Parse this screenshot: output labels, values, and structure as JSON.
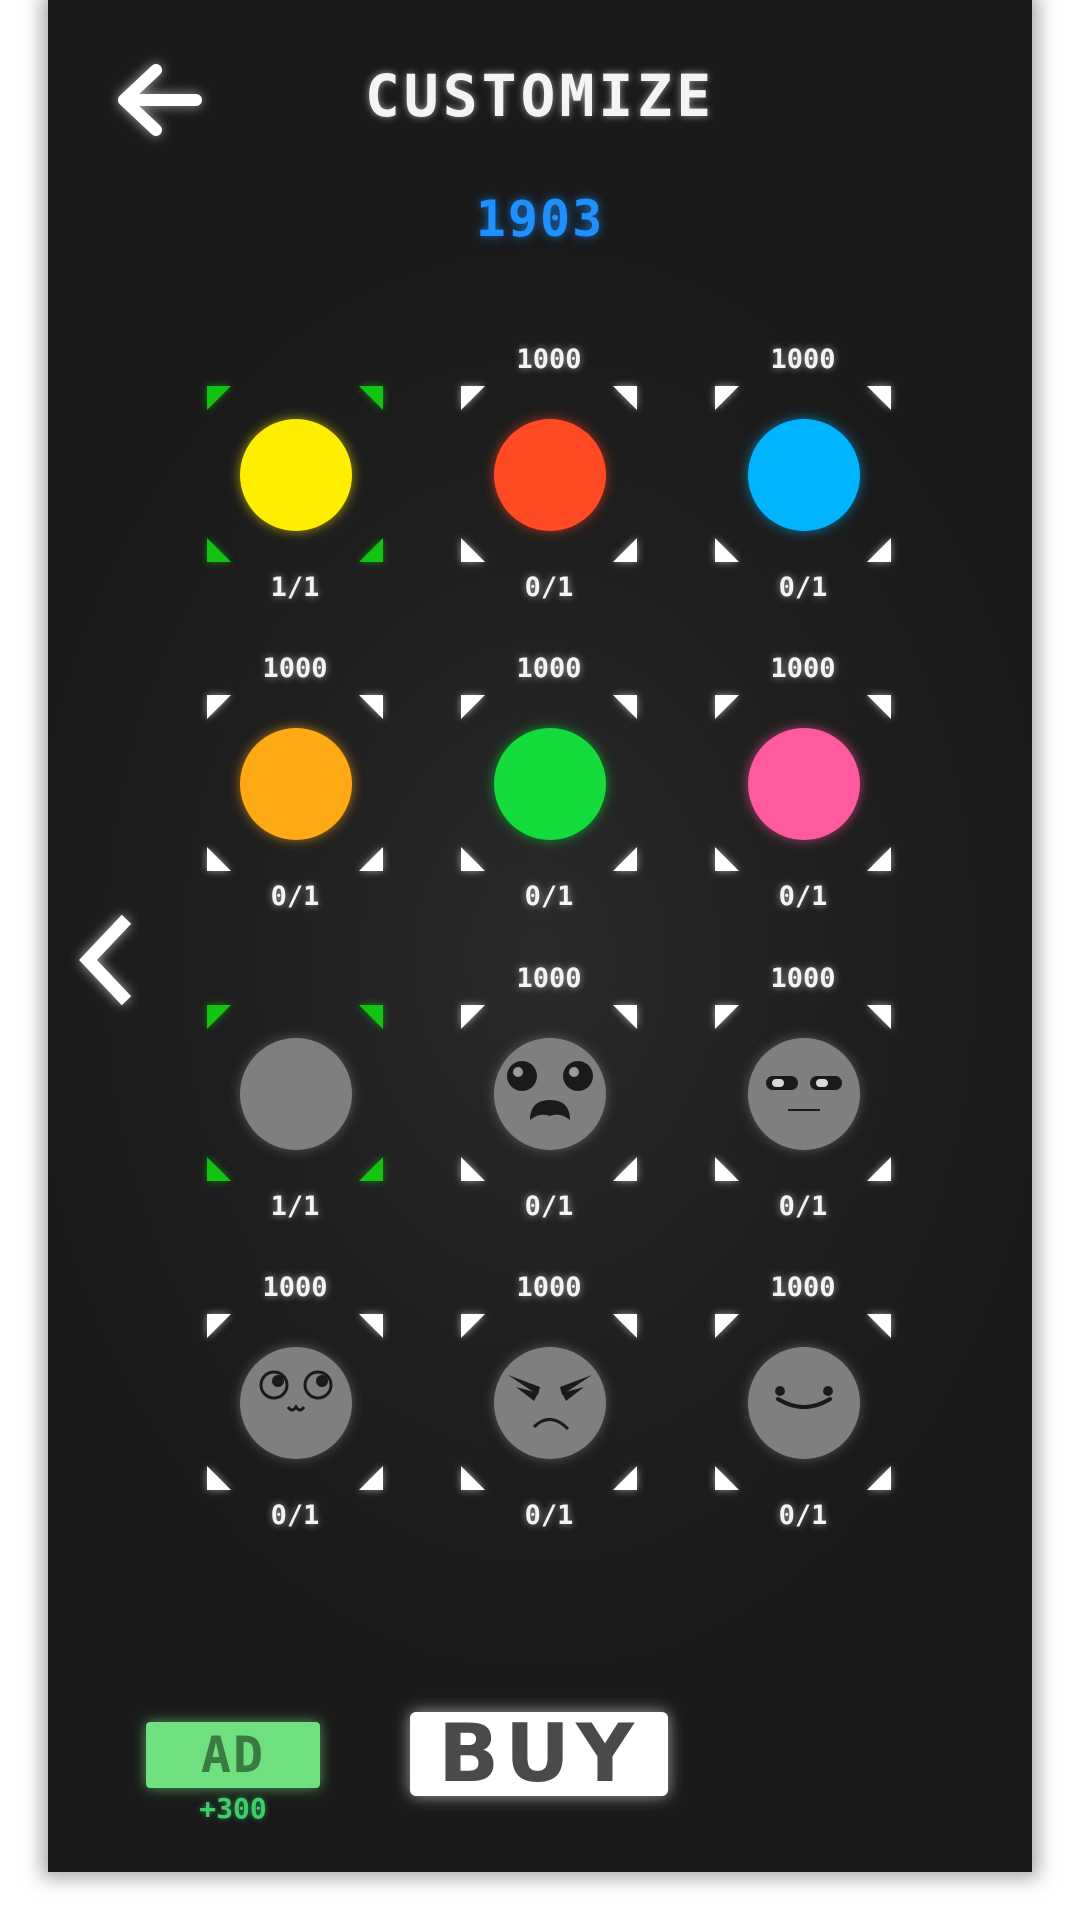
{
  "header": {
    "title": "CUSTOMIZE",
    "back_icon": "arrow-left-icon"
  },
  "wallet": {
    "coins": "1903",
    "color": "#1e90ff"
  },
  "navigation": {
    "prev_icon": "chevron-left-icon"
  },
  "items": [
    {
      "name": "yellow",
      "price": "",
      "count": "1/1",
      "owned": true,
      "color": "#ffee00",
      "face": "none"
    },
    {
      "name": "red",
      "price": "1000",
      "count": "0/1",
      "owned": false,
      "color": "#ff4a24",
      "face": "none"
    },
    {
      "name": "blue",
      "price": "1000",
      "count": "0/1",
      "owned": false,
      "color": "#00b4ff",
      "face": "none"
    },
    {
      "name": "orange",
      "price": "1000",
      "count": "0/1",
      "owned": false,
      "color": "#ffaa14",
      "face": "none"
    },
    {
      "name": "green",
      "price": "1000",
      "count": "0/1",
      "owned": false,
      "color": "#14dc3c",
      "face": "none"
    },
    {
      "name": "pink",
      "price": "1000",
      "count": "0/1",
      "owned": false,
      "color": "#ff5aa0",
      "face": "none"
    },
    {
      "name": "plain-gray",
      "price": "",
      "count": "1/1",
      "owned": true,
      "color": "#7f7f7f",
      "face": "none"
    },
    {
      "name": "scared-face",
      "price": "1000",
      "count": "0/1",
      "owned": false,
      "color": "#7f7f7f",
      "face": "scared"
    },
    {
      "name": "bored-face",
      "price": "1000",
      "count": "0/1",
      "owned": false,
      "color": "#7f7f7f",
      "face": "bored"
    },
    {
      "name": "cute-face",
      "price": "1000",
      "count": "0/1",
      "owned": false,
      "color": "#7f7f7f",
      "face": "cute"
    },
    {
      "name": "angry-face",
      "price": "1000",
      "count": "0/1",
      "owned": false,
      "color": "#7f7f7f",
      "face": "angry"
    },
    {
      "name": "smile-face",
      "price": "1000",
      "count": "0/1",
      "owned": false,
      "color": "#7f7f7f",
      "face": "smile"
    }
  ],
  "footer": {
    "ad_label": "AD",
    "ad_reward": "+300",
    "buy_label": "BUY",
    "ad_color": "#6fe07f"
  }
}
